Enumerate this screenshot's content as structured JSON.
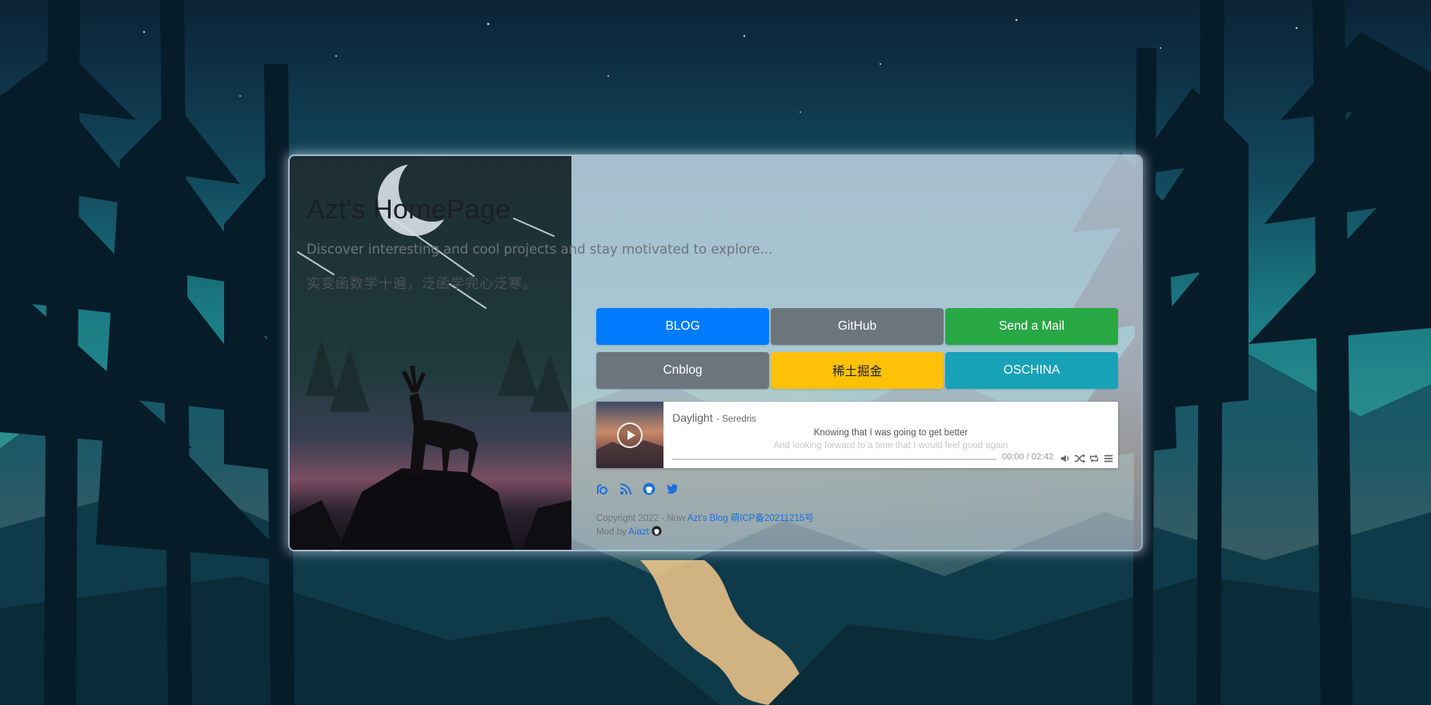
{
  "site": {
    "title": "Azt's HomePage",
    "subtitle": "Discover interesting and cool projects and stay motivated to explore...",
    "motto": "实变函数学十遍，泛函学完心泛寒。"
  },
  "buttons": [
    {
      "label": "BLOG",
      "color": "#007bff"
    },
    {
      "label": "GitHub",
      "color": "#6c757d"
    },
    {
      "label": "Send a Mail",
      "color": "#28a745"
    },
    {
      "label": "Cnblog",
      "color": "#6c757d"
    },
    {
      "label": "稀土掘金",
      "color": "#ffc107"
    },
    {
      "label": "OSCHINA",
      "color": "#17a2b8"
    }
  ],
  "player": {
    "song_title": "Daylight",
    "song_artist": "- Seredris",
    "lyric_current": "Knowing that I was going to get better",
    "lyric_next": "And looking forward to a time that I would feel good again",
    "time": "00:00 / 02:42",
    "progress": 0
  },
  "social_icons": [
    "blog-icon",
    "rss-icon",
    "github-icon",
    "twitter-icon"
  ],
  "footer": {
    "copyright": "Copyright 2022 - Now",
    "blog_link": "Azt's Blog",
    "icp_link": "萌ICP备20211215号",
    "mod_by": "Mod by",
    "author_link": "Aiazt"
  }
}
